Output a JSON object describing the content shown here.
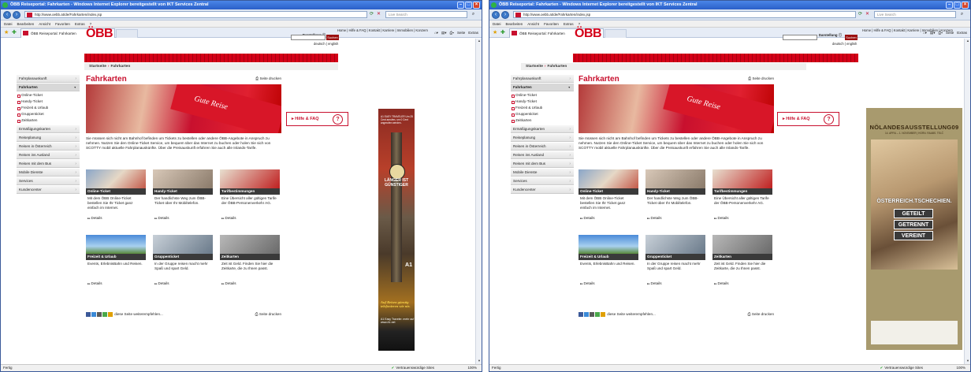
{
  "window": {
    "title": "ÖBB Reiseportal: Fahrkarten - Windows Internet Explorer bereitgestellt von IKT Services Zentral",
    "address": "http://www.oebb.at/de/Fahrkarten/index.jsp",
    "search_placeholder": "Live Search",
    "menu": [
      "Datei",
      "Bearbeiten",
      "Ansicht",
      "Favoriten",
      "Extras",
      "?"
    ],
    "tab_title": "ÖBB Reiseportal: Fahrkarten",
    "cmd": [
      "Seite",
      "Extras"
    ],
    "status": "Fertig",
    "trusted": "Vertrauenswürdige Sites",
    "zoom": "100%"
  },
  "site": {
    "logo": "ÖBB",
    "top_links": "Home | Hilfe & FAQ | Kontakt | Karriere | Immobilien | Konzern",
    "darstellung": "Darstellung",
    "search_button": "Suchen",
    "lang": "deutsch | english",
    "breadcrumb": [
      "Startseite",
      "Fahrkarten"
    ],
    "nav": {
      "top": [
        "Fahrplanauskunft",
        "Fahrkarten"
      ],
      "sub": [
        "Online-Ticket",
        "Handy-Ticket",
        "Freizeit & Urlaub",
        "Gruppenticket",
        "Zeitkarten"
      ],
      "bottom": [
        "Ermäßigungskarten",
        "Reiseplanung",
        "Reisen in Österreich",
        "Reisen ins Ausland",
        "Reisen mit dem Bus",
        "Mobile Dienste",
        "Services",
        "Kundencenter"
      ]
    },
    "page_title": "Fahrkarten",
    "print": "Seite drucken",
    "hero_text": "Gute Reise",
    "intro": "Sie müssen sich nicht am Bahnhof befinden um Tickets zu bestellen oder andere ÖBB-Angebote in Anspruch zu nehmen. Nutzen Sie den Online-Ticket Service, um bequem über das Internet zu buchen oder holen Sie sich von SCOTTY mobil aktuelle Fahrplanauskünfte. Über die Preisauskunft erfahren Sie auch alle Inlands-Tarife.",
    "details": "Details",
    "tiles": [
      {
        "title": "Online-Ticket",
        "text": "Mit dem ÖBB Online-Ticket bestellen Sie Ihr Ticket ganz einfach im Internet."
      },
      {
        "title": "Handy-Ticket",
        "text": "Der handlichste Weg zum ÖBB-Ticket über Ihr Mobiltelefon."
      },
      {
        "title": "Tarifbestimmungen",
        "text": "Eine Übersicht aller gültigen Tarife der ÖBB-Personenverkehr AG."
      },
      {
        "title": "Freizeit & Urlaub",
        "text": "Events, ErlebnisBahn und Reisen."
      },
      {
        "title": "Gruppenticket",
        "text": "In der Gruppe reisen macht mehr Spaß und spart Geld."
      },
      {
        "title": "Zeitkarten",
        "text": "Zeit ist Geld. Finden Sie hier die Zeitkarte, die zu Ihnen passt."
      }
    ],
    "share": "diese Seite weiterempfehlen...",
    "hilfe": "Hilfe & FAQ",
    "hilfe_icon": "?"
  },
  "ads": {
    "left": {
      "top": "A1 EASY TRAVELER Um 25 Cent anrufen, um 0 Cent angerufen werden.",
      "middle": "LÄNGER IST GÜNSTIGER",
      "brand": "A1",
      "bottom": "Auf Reisen günstig telefonieren wie nie.",
      "cta": "A1 Easy Traveler. mehr auf www.A1.net"
    },
    "right": {
      "title": "NÖLANDESAUSSTELLUNG09",
      "dates": "14. APRIL – 1. NOVEMBER | HORN. RAABS. TELČ",
      "line": "ÖSTERREICH.TSCHECHIEN.",
      "words": [
        "GETEILT",
        "GETRENNT",
        "VEREINT"
      ]
    }
  }
}
